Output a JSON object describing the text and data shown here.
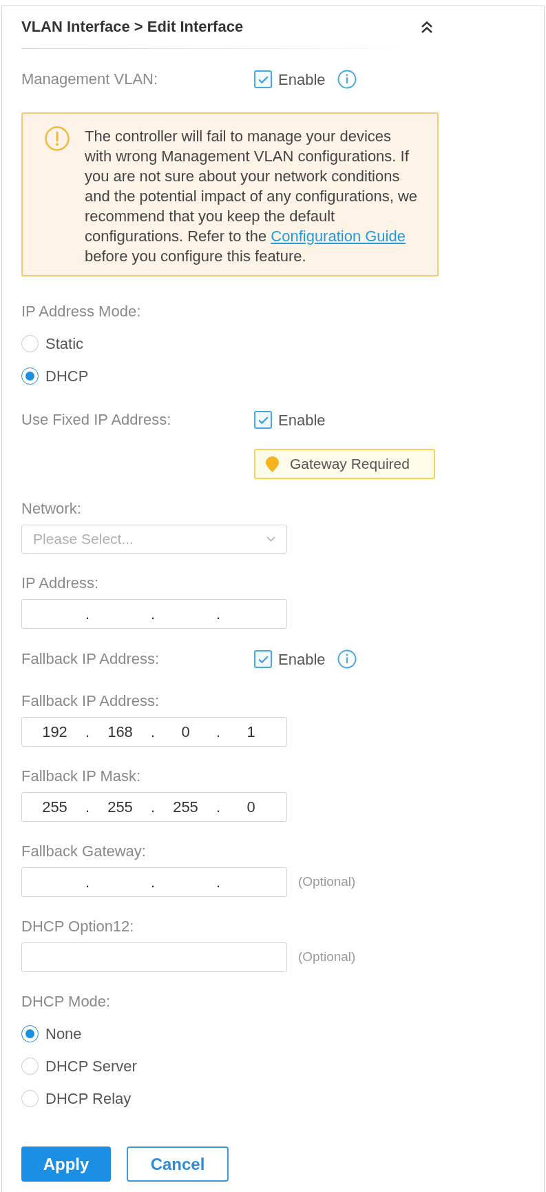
{
  "panel": {
    "title": "VLAN Interface > Edit Interface"
  },
  "form": [
    {
      "kind": "toggle",
      "label": "Management VLAN:",
      "checkbox": {
        "label": "Enable",
        "checked": true
      },
      "info": true
    },
    {
      "kind": "warning",
      "text": "The controller will fail to manage your devices with wrong Management VLAN configurations. If you are not sure about your network conditions and the potential impact of any configurations, we recommend that you keep the default configurations. Refer to the",
      "link": "Configuration Guide",
      "text_after": "before you configure this feature."
    },
    {
      "kind": "radio",
      "label": "IP Address Mode:",
      "options": [
        {
          "label": "Static",
          "selected": false
        },
        {
          "label": "DHCP",
          "selected": true
        }
      ]
    },
    {
      "kind": "toggle",
      "label": "Use Fixed IP Address:",
      "checkbox": {
        "label": "Enable",
        "checked": true
      },
      "hint": "Gateway Required"
    },
    {
      "kind": "select",
      "label": "Network:",
      "placeholder": "Please Select..."
    },
    {
      "kind": "ip",
      "label": "IP Address:",
      "separators": [
        ".",
        ".",
        "."
      ]
    },
    {
      "kind": "toggle",
      "label": "Fallback IP Address:",
      "checkbox": {
        "label": "Enable",
        "checked": true
      },
      "info": true
    },
    {
      "kind": "ip",
      "label": "Fallback IP Address:",
      "octets": [
        "192",
        "168",
        "0",
        "1"
      ],
      "separators": [
        ".",
        ".",
        "."
      ]
    },
    {
      "kind": "ip",
      "label": "Fallback IP Mask:",
      "octets": [
        "255",
        "255",
        "255",
        "0"
      ],
      "separators": [
        ".",
        ".",
        "."
      ]
    },
    {
      "kind": "ip",
      "label": "Fallback Gateway:",
      "separators": [
        ".",
        ".",
        "."
      ],
      "note": "(Optional)"
    },
    {
      "kind": "text",
      "label": "DHCP Option12:",
      "note": "(Optional)"
    },
    {
      "kind": "radio",
      "label": "DHCP Mode:",
      "options": [
        {
          "label": "None",
          "selected": true
        },
        {
          "label": "DHCP Server",
          "selected": false
        },
        {
          "label": "DHCP Relay",
          "selected": false
        }
      ]
    }
  ],
  "buttons": [
    {
      "label": "Apply",
      "kind": "primary"
    },
    {
      "label": "Cancel",
      "kind": "secondary"
    }
  ]
}
